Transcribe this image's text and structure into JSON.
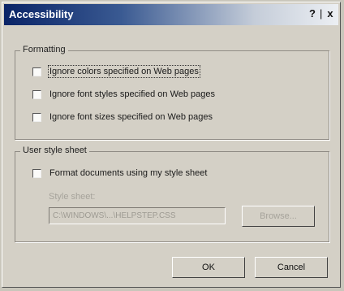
{
  "dialog": {
    "title": "Accessibility",
    "help_label": "?",
    "close_label": "x"
  },
  "formatting": {
    "group_label": "Formatting",
    "options": [
      {
        "label": "Ignore colors specified on Web pages",
        "checked": false
      },
      {
        "label": "Ignore font styles specified on Web pages",
        "checked": false
      },
      {
        "label": "Ignore font sizes specified on Web pages",
        "checked": false
      }
    ]
  },
  "user_style_sheet": {
    "group_label": "User style sheet",
    "checkbox_label": "Format documents using my style sheet",
    "checked": false,
    "style_sheet_label": "Style sheet:",
    "style_sheet_value": "C:\\WINDOWS\\...\\HELPSTEP.CSS",
    "browse_label": "Browse..."
  },
  "buttons": {
    "ok_label": "OK",
    "cancel_label": "Cancel"
  }
}
